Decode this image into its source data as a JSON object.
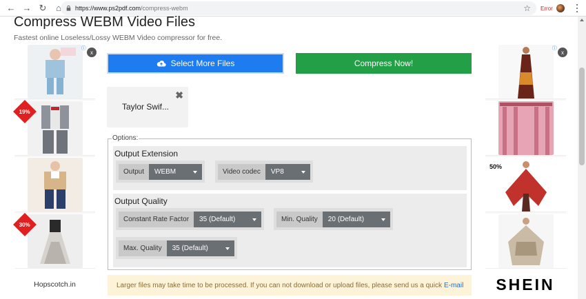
{
  "browser": {
    "url_host": "https://www.ps2pdf.com",
    "url_path": "/compress-webm",
    "error_label": "Error"
  },
  "page": {
    "title": "Compress WEBM Video Files",
    "subtitle": "Fastest online Loseless/Lossy WEBM Video compressor for free."
  },
  "actions": {
    "select_label": "Select More Files",
    "compress_label": "Compress Now!"
  },
  "file": {
    "name": "Taylor Swif..."
  },
  "options": {
    "legend": "Options:",
    "output_extension": {
      "title": "Output Extension",
      "output_label": "Output",
      "output_value": "WEBM",
      "codec_label": "Video codec",
      "codec_value": "VP8"
    },
    "output_quality": {
      "title": "Output Quality",
      "crf_label": "Constant Rate Factor",
      "crf_value": "35 (Default)",
      "min_label": "Min. Quality",
      "min_value": "20 (Default)",
      "max_label": "Max. Quality",
      "max_value": "35 (Default)"
    }
  },
  "notice": {
    "text": "Larger files may take time to be processed. If you can not download or upload files, please send us a quick",
    "link": "E-mail"
  },
  "ads": {
    "left": {
      "badge1": "19%",
      "badge2": "30%",
      "caption": "Hopscotch.in",
      "close": "x"
    },
    "right": {
      "pct": "50%",
      "brand": "SHEIN",
      "close": "x"
    },
    "info_icon": "ⓘ"
  },
  "colors": {
    "select_btn": "#1e7cf0",
    "compress_btn": "#23a047",
    "select_bg": "#6a6f74"
  }
}
